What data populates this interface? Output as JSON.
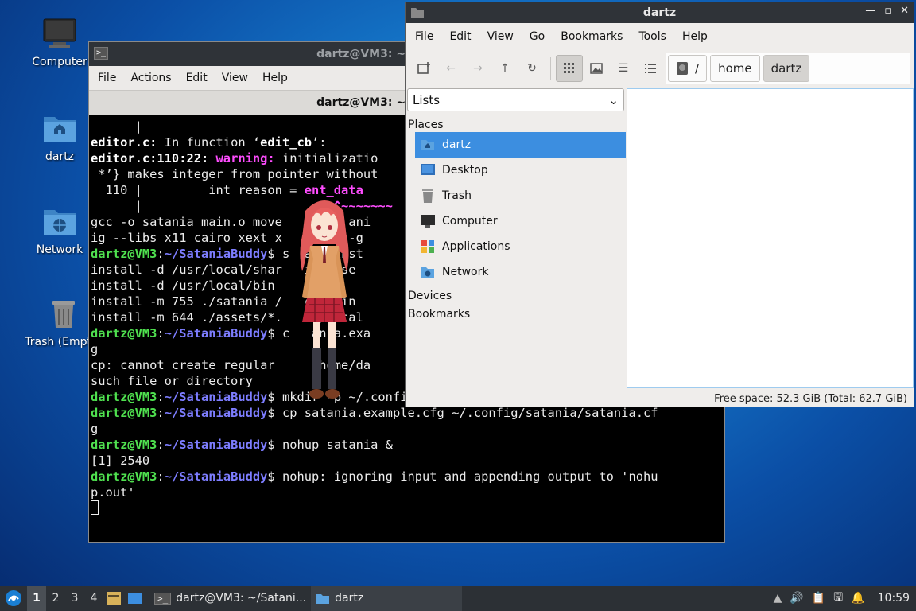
{
  "desktop": {
    "icons": [
      {
        "label": "Computer",
        "icon": "monitor-icon"
      },
      {
        "label": "dartz",
        "icon": "home-folder-icon"
      },
      {
        "label": "Network",
        "icon": "network-folder-icon"
      },
      {
        "label": "Trash (Empty)",
        "icon": "trash-icon"
      }
    ]
  },
  "terminal": {
    "title": "dartz@VM3: ~/SataniaBuddy",
    "menu": [
      "File",
      "Actions",
      "Edit",
      "View",
      "Help"
    ],
    "tab_title": "dartz@VM3: ~/SataniaBuddy",
    "prompt_user": "dartz@VM3",
    "prompt_path": "~/SataniaBuddy",
    "lines": {
      "l1": "      |",
      "l2_file": "editor.c:",
      "l2_rest": " In function ‘",
      "l2_fn": "edit_cb",
      "l2_end": "’:",
      "l3_loc": "editor.c:110:22:",
      "l3_warn": " warning:",
      "l3_rest": " initializatio",
      "l4": " *’} makes integer from pointer without",
      "l5_pre": "  110 |         int reason = ",
      "l5_hl": "ent_data",
      "l6_pre": "      |                          ",
      "l6_hl": "^~~~~~~~",
      "l7": "gcc -o satania main.o move   .se.o ani",
      "l8": "ig --libs x11 cairo xext x   hread -g",
      "l9_cmd": "$ s  ake inst",
      "l10": "install -d /usr/local/shar   ia/asse",
      "l11": "install -d /usr/local/bin",
      "l12": "install -m 755 ./satania /   cal/bin",
      "l13": "install -m 644 ./assets/*.   sr/local",
      "l14_cmd": "$ c   ania.exa",
      "l15": "g",
      "l16": "cp: cannot create regular     /home/da",
      "l17": "such file or directory",
      "l18_cmd": "$ mkdir -p ~/.config/satania",
      "l19_cmd": "$ cp satania.example.cfg ~/.config/satania/satania.cf",
      "l20": "g",
      "l21_cmd": "$ nohup satania &",
      "l22": "[1] 2540",
      "l23_cmd": "$ nohup: ignoring input and appending output to 'nohu",
      "l24": "p.out'"
    }
  },
  "file_manager": {
    "title": "dartz",
    "menu": [
      "File",
      "Edit",
      "View",
      "Go",
      "Bookmarks",
      "Tools",
      "Help"
    ],
    "breadcrumbs": [
      "/",
      "home",
      "dartz"
    ],
    "side_mode": "Lists",
    "sections": {
      "places": "Places",
      "devices": "Devices",
      "bookmarks": "Bookmarks"
    },
    "places": [
      {
        "label": "dartz",
        "icon": "home-folder-icon",
        "selected": true
      },
      {
        "label": "Desktop",
        "icon": "desktop-icon"
      },
      {
        "label": "Trash",
        "icon": "trash-icon"
      },
      {
        "label": "Computer",
        "icon": "monitor-icon"
      },
      {
        "label": "Applications",
        "icon": "applications-icon"
      },
      {
        "label": "Network",
        "icon": "network-folder-icon"
      }
    ],
    "status": "Free space: 52.3 GiB (Total: 62.7 GiB)"
  },
  "taskbar": {
    "workspaces": [
      "1",
      "2",
      "3",
      "4"
    ],
    "tasks": [
      {
        "label": "dartz@VM3: ~/Satani...",
        "icon": "terminal-icon"
      },
      {
        "label": "dartz",
        "icon": "folder-icon"
      }
    ],
    "clock": "10:59"
  },
  "colors": {
    "selection": "#3c8ee0",
    "prompt_green": "#4fe04f",
    "prompt_blue": "#7d7dff",
    "warning_magenta": "#ff4dff",
    "titlebar": "#2f3338"
  }
}
